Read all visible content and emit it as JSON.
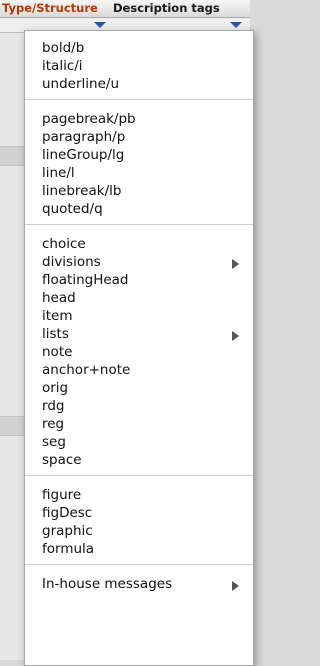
{
  "tabs": {
    "type_structure": "Type/Structure",
    "description_tags": "Description tags"
  },
  "menu": {
    "groups": [
      {
        "items": [
          {
            "label": "bold/b"
          },
          {
            "label": "italic/i"
          },
          {
            "label": "underline/u"
          }
        ]
      },
      {
        "items": [
          {
            "label": "pagebreak/pb"
          },
          {
            "label": "paragraph/p"
          },
          {
            "label": "lineGroup/lg"
          },
          {
            "label": "line/l"
          },
          {
            "label": "linebreak/lb"
          },
          {
            "label": "quoted/q"
          }
        ]
      },
      {
        "items": [
          {
            "label": "choice"
          },
          {
            "label": "divisions",
            "submenu": true
          },
          {
            "label": "floatingHead"
          },
          {
            "label": "head"
          },
          {
            "label": "item"
          },
          {
            "label": "lists",
            "submenu": true
          },
          {
            "label": "note"
          },
          {
            "label": "anchor+note"
          },
          {
            "label": "orig"
          },
          {
            "label": "rdg"
          },
          {
            "label": "reg"
          },
          {
            "label": "seg"
          },
          {
            "label": "space"
          }
        ]
      },
      {
        "items": [
          {
            "label": "figure"
          },
          {
            "label": "figDesc"
          },
          {
            "label": "graphic"
          },
          {
            "label": "formula"
          }
        ]
      },
      {
        "items": [
          {
            "label": "In-house messages",
            "submenu": true
          }
        ]
      }
    ]
  },
  "colors": {
    "type_tab": "#b23a00",
    "dropdown_arrow": "#2b55a6"
  },
  "icons": {
    "dropdown": "triangle-down-icon",
    "submenu": "triangle-right-icon"
  }
}
